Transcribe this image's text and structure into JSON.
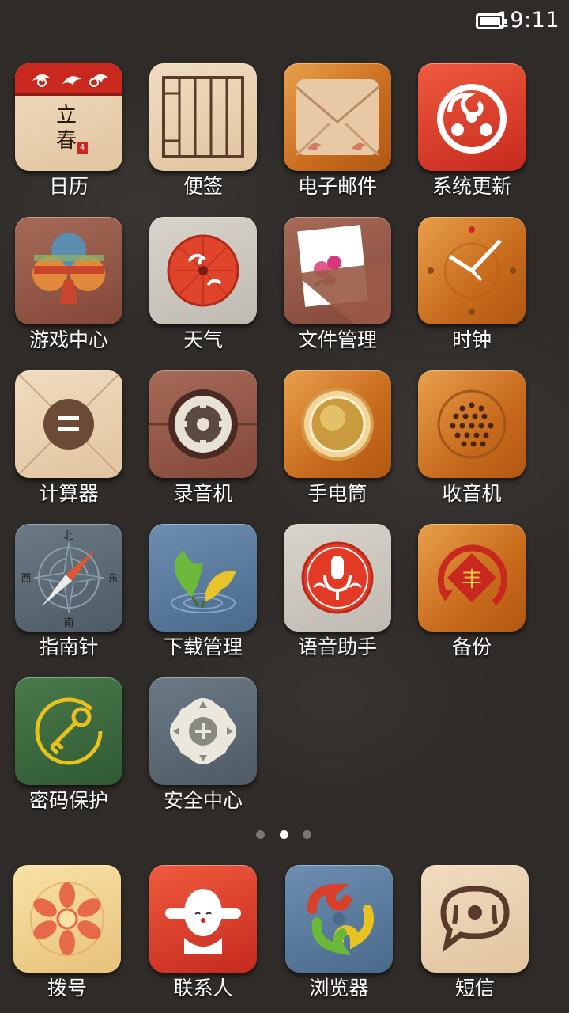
{
  "status_bar": {
    "time": "19:11",
    "battery_icon": "battery-full-icon"
  },
  "apps": [
    {
      "label": "日历",
      "icon": "calendar-icon",
      "calendar_text": "立春",
      "calendar_day": "4"
    },
    {
      "label": "便签",
      "icon": "notes-icon"
    },
    {
      "label": "电子邮件",
      "icon": "email-envelope-icon"
    },
    {
      "label": "系统更新",
      "icon": "system-update-cloud-icon"
    },
    {
      "label": "游戏中心",
      "icon": "game-club-icon"
    },
    {
      "label": "天气",
      "icon": "weather-umbrella-icon"
    },
    {
      "label": "文件管理",
      "icon": "file-folder-icon"
    },
    {
      "label": "时钟",
      "icon": "clock-icon"
    },
    {
      "label": "计算器",
      "icon": "calculator-icon"
    },
    {
      "label": "录音机",
      "icon": "recorder-reel-icon"
    },
    {
      "label": "手电筒",
      "icon": "flashlight-icon"
    },
    {
      "label": "收音机",
      "icon": "radio-speaker-icon"
    },
    {
      "label": "指南针",
      "icon": "compass-icon",
      "directions": [
        "北",
        "东",
        "南",
        "西"
      ]
    },
    {
      "label": "下载管理",
      "icon": "download-ginkgo-icon"
    },
    {
      "label": "语音助手",
      "icon": "voice-mic-icon"
    },
    {
      "label": "备份",
      "icon": "backup-icon",
      "backup_char": "丰"
    },
    {
      "label": "密码保护",
      "icon": "password-key-icon"
    },
    {
      "label": "安全中心",
      "icon": "security-shield-icon"
    }
  ],
  "pager": {
    "pages": 3,
    "active_index": 1
  },
  "dock": [
    {
      "label": "拨号",
      "icon": "dialer-lotus-icon"
    },
    {
      "label": "联系人",
      "icon": "contacts-figure-icon"
    },
    {
      "label": "浏览器",
      "icon": "browser-clouds-icon"
    },
    {
      "label": "短信",
      "icon": "sms-bubble-icon"
    }
  ],
  "colors": {
    "background": "#2f2b28",
    "label": "#ffffff",
    "accent_red": "#d23b24"
  }
}
